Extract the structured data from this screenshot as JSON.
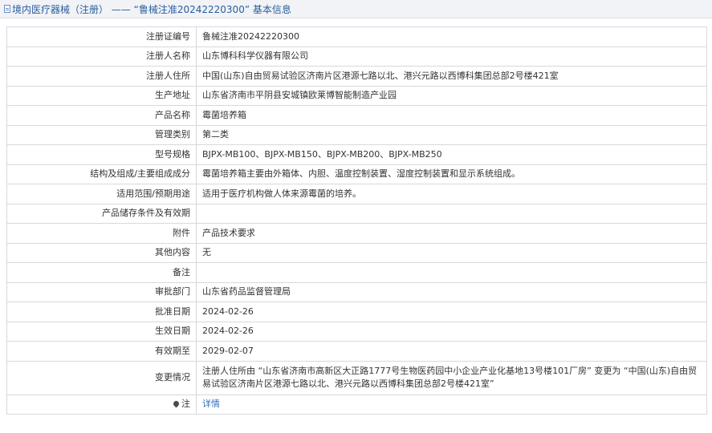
{
  "header": {
    "title": "境内医疗器械（注册） —— “鲁械注准20242220300” 基本信息"
  },
  "rows": [
    {
      "label": "注册证编号",
      "value": "鲁械注准20242220300"
    },
    {
      "label": "注册人名称",
      "value": "山东博科科学仪器有限公司"
    },
    {
      "label": "注册人住所",
      "value": "中国(山东)自由贸易试验区济南片区港源七路以北、港兴元路以西博科集团总部2号楼421室"
    },
    {
      "label": "生产地址",
      "value": "山东省济南市平阴县安城镇欧莱博智能制造产业园"
    },
    {
      "label": "产品名称",
      "value": "霉菌培养箱"
    },
    {
      "label": "管理类别",
      "value": "第二类"
    },
    {
      "label": "型号规格",
      "value": "BJPX-MB100、BJPX-MB150、BJPX-MB200、BJPX-MB250"
    },
    {
      "label": "结构及组成/主要组成成分",
      "value": "霉菌培养箱主要由外箱体、内胆、温度控制装置、湿度控制装置和显示系统组成。"
    },
    {
      "label": "适用范围/预期用途",
      "value": "适用于医疗机构做人体来源霉菌的培养。"
    },
    {
      "label": "产品储存条件及有效期",
      "value": ""
    },
    {
      "label": "附件",
      "value": "产品技术要求"
    },
    {
      "label": "其他内容",
      "value": "无"
    },
    {
      "label": "备注",
      "value": ""
    },
    {
      "label": "审批部门",
      "value": "山东省药品监督管理局"
    },
    {
      "label": "批准日期",
      "value": "2024-02-26"
    },
    {
      "label": "生效日期",
      "value": "2024-02-26"
    },
    {
      "label": "有效期至",
      "value": "2029-02-07"
    },
    {
      "label": "变更情况",
      "value": "注册人住所由 “山东省济南市高新区大正路1777号生物医药园中小企业产业化基地13号楼101厂房” 变更为 “中国(山东)自由贸易试验区济南片区港源七路以北、港兴元路以西博科集团总部2号楼421室”"
    }
  ],
  "note_row": {
    "label": "注",
    "link": "详情"
  }
}
